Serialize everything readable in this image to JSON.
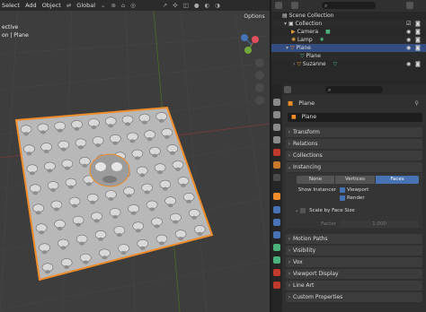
{
  "viewport_header": {
    "menus": [
      "Select",
      "Add",
      "Object"
    ],
    "transform_orientation": "Global",
    "options_label": "Options"
  },
  "viewport": {
    "view_label": "ective",
    "object_label": "on | Plane"
  },
  "outliner": {
    "rows": [
      {
        "label": "Scene Collection",
        "depth": 0
      },
      {
        "label": "Collection",
        "depth": 1
      },
      {
        "label": "Camera",
        "depth": 2
      },
      {
        "label": "Lamp",
        "depth": 2
      },
      {
        "label": "Plane",
        "depth": 2
      },
      {
        "label": "Plane",
        "depth": 3
      },
      {
        "label": "Suzanne",
        "depth": 3
      }
    ]
  },
  "properties": {
    "object_name": "Plane",
    "object_field": "Plane",
    "panels": {
      "transform": "Transform",
      "relations": "Relations",
      "collections": "Collections",
      "instancing": "Instancing",
      "motion_paths": "Motion Paths",
      "visibility": "Visibility",
      "vox": "Vox",
      "viewport_display": "Viewport Display",
      "line_art": "Line Art",
      "custom_properties": "Custom Properties"
    },
    "instancing": {
      "options": [
        "None",
        "Vertices",
        "Faces"
      ],
      "selected": "Faces",
      "show_instancer_label": "Show Instancer",
      "viewport_label": "Viewport",
      "render_label": "Render",
      "scale_by_face_size": "Scale by Face Size",
      "factor_label": "Factor",
      "factor_value": "1.000"
    }
  },
  "colors": {
    "selection_orange": "#f08c2a",
    "selected_row": "#334d80",
    "accent_blue": "#4772b3"
  },
  "icons": [
    "object-mode-icon",
    "transform-icon",
    "eye-icon",
    "camera-icon",
    "lamp-icon",
    "mesh-icon",
    "monkey-icon",
    "search-icon",
    "pin-icon"
  ]
}
